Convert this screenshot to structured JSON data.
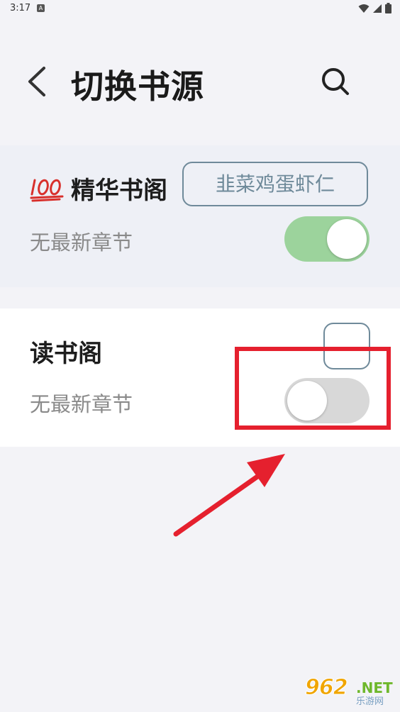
{
  "status_bar": {
    "time": "3:17",
    "indicator": "A",
    "icons": [
      "wifi-icon",
      "signal-icon",
      "battery-icon"
    ]
  },
  "header": {
    "title": "切换书源",
    "back_icon": "chevron-left-icon",
    "search_icon": "search-icon"
  },
  "sources": [
    {
      "name": "精华书阁",
      "badge_icon": "hundred-points-icon",
      "book_name": "韭菜鸡蛋虾仁",
      "latest": "无最新章节",
      "enabled": true
    },
    {
      "name": "读书阁",
      "book_name": "",
      "latest": "无最新章节",
      "enabled": false
    }
  ],
  "colors": {
    "background": "#f3f3f7",
    "card_selected_bg": "#eef0f6",
    "toggle_on": "#9cd39c",
    "toggle_off": "#d8d8d8",
    "outline": "#6f8a9a",
    "annotation": "#e5202e"
  },
  "watermark": {
    "number": "962",
    "suffix": ".NET",
    "site": "乐游网"
  }
}
